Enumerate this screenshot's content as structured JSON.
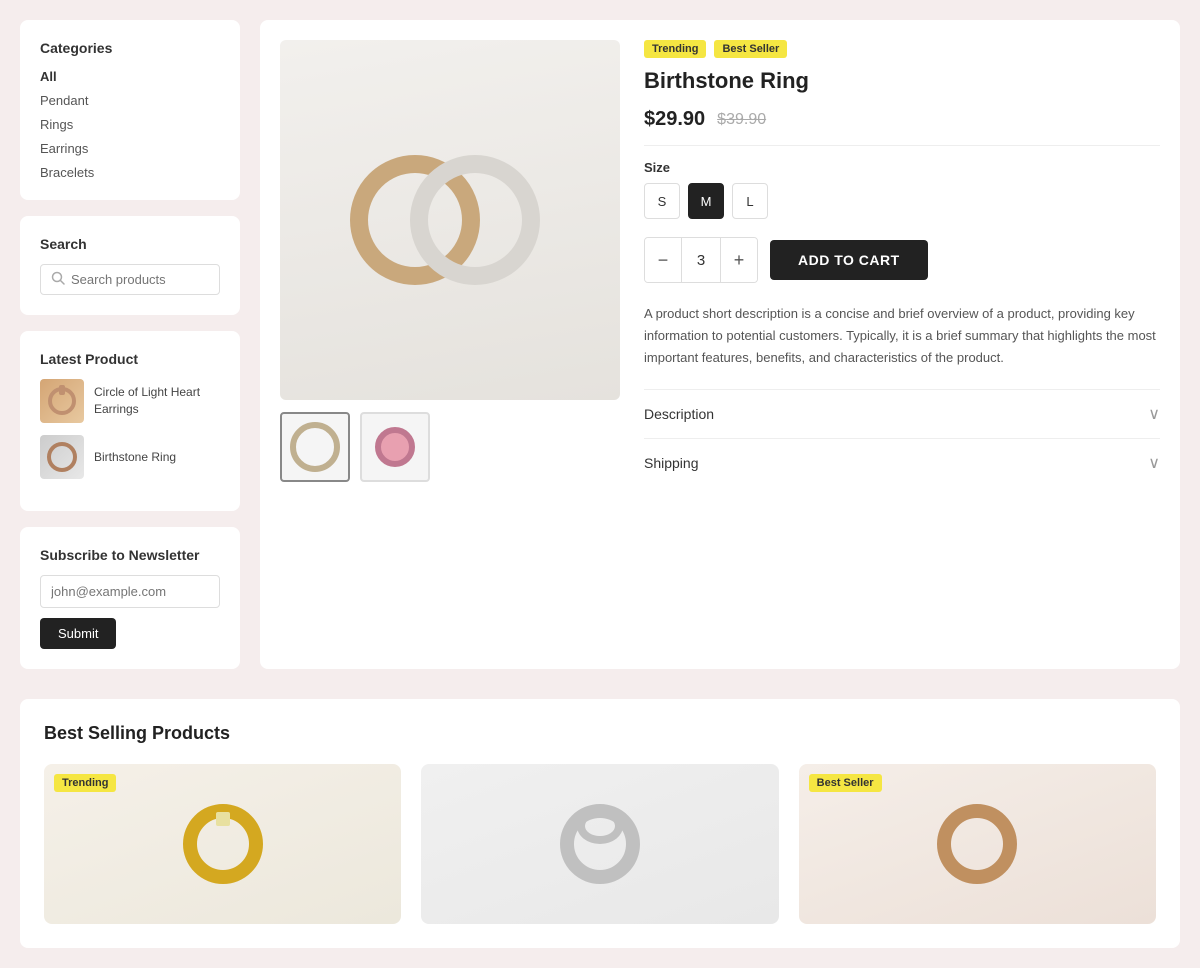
{
  "sidebar": {
    "categories_title": "Categories",
    "categories": [
      {
        "label": "All",
        "active": true
      },
      {
        "label": "Pendant",
        "active": false
      },
      {
        "label": "Rings",
        "active": false
      },
      {
        "label": "Earrings",
        "active": false
      },
      {
        "label": "Bracelets",
        "active": false
      }
    ],
    "search": {
      "title": "Search",
      "placeholder": "Search products"
    },
    "latest_product": {
      "title": "Latest Product",
      "items": [
        {
          "name": "Circle of Light Heart Earrings"
        },
        {
          "name": "Birthstone Ring"
        }
      ]
    },
    "newsletter": {
      "title": "Subscribe to Newsletter",
      "placeholder": "john@example.com",
      "submit_label": "Submit"
    }
  },
  "product": {
    "badges": [
      "Trending",
      "Best Seller"
    ],
    "title": "Birthstone Ring",
    "price_current": "$29.90",
    "price_original": "$39.90",
    "size_label": "Size",
    "sizes": [
      "S",
      "M",
      "L"
    ],
    "selected_size": "M",
    "quantity": "3",
    "add_to_cart_label": "ADD TO CART",
    "description": "A product short description is a concise and brief overview of a product, providing key information to potential customers. Typically, it is a brief summary that highlights the most important features, benefits, and characteristics of the product.",
    "accordion": [
      {
        "label": "Description"
      },
      {
        "label": "Shipping"
      }
    ]
  },
  "best_selling": {
    "title": "Best Selling Products",
    "products": [
      {
        "badge": "Trending",
        "badge_type": "trending"
      },
      {
        "badge": "",
        "badge_type": ""
      },
      {
        "badge": "Best Seller",
        "badge_type": "bestseller"
      }
    ]
  }
}
